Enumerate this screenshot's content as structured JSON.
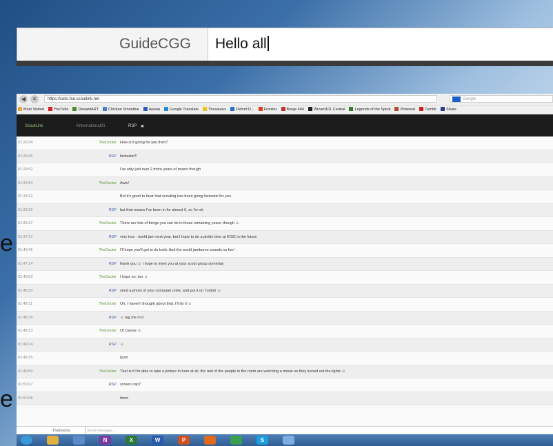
{
  "slide_fragments": {
    "upper_letter": "e",
    "lower_letter": "e"
  },
  "zoom_input": {
    "nick": "GuideCGG",
    "value": "Hello all"
  },
  "browser": {
    "url": "https://cells.hut.scoutlink.net",
    "search_placeholder": "Google",
    "bookmarks": [
      "Most Visited",
      "YouTube",
      "DeviantART",
      "Chicken Smoothie",
      "Ayuwa",
      "Google Translate",
      "Thesaurus",
      "Oxford D...",
      "Frontier",
      "Borge 494",
      "Wizard101 Central",
      "Legends of the Spiral",
      "Pinterest",
      "Tumblr",
      "Share"
    ],
    "app_tabs": [
      "ScoutLink",
      "#international01",
      "RSP"
    ],
    "compose": {
      "nick": "TheDoctor",
      "placeholder": "Send message..."
    }
  },
  "chat_log": [
    {
      "time": "01:29:34",
      "nick": "TheDoctor",
      "text": "How is it going for you then?"
    },
    {
      "time": "01:29:46",
      "nick": "RSP",
      "text": "fantastic!!!"
    },
    {
      "time": "01:29:52",
      "nick": "",
      "text": "I've only just over 2 more years of rovers though"
    },
    {
      "time": "01:32:54",
      "nick": "TheDoctor",
      "text": "Aww!"
    },
    {
      "time": "01:33:22",
      "nick": "",
      "text": "But it's good to hear that scouting has been going fantastic for you"
    },
    {
      "time": "01:33:22",
      "nick": "RSP",
      "text": "but that means I've been in for almost 6, so I'm ok"
    },
    {
      "time": "01:36:37",
      "nick": "TheDoctor",
      "text": "There are lots of things you can do in those remaining years, though ☺"
    },
    {
      "time": "01:37:17",
      "nick": "RSP",
      "text": "very true - world jam next year. but I hope to do a pinkie time at KISC in the future"
    },
    {
      "time": "01:40:45",
      "nick": "TheDoctor",
      "text": "I'll hope you'll get to do both. And the world jamboree sounds so fun!"
    },
    {
      "time": "01:47:14",
      "nick": "RSP",
      "text": "thank you ☺ I hope to meet you at your scout group someday"
    },
    {
      "time": "01:48:03",
      "nick": "TheDoctor",
      "text": "I hope so, too ☺"
    },
    {
      "time": "01:48:33",
      "nick": "RSP",
      "text": "send a photo of your computer onlie, and put it on Tumblr ☺"
    },
    {
      "time": "01:48:11",
      "nick": "TheDoctor",
      "text": "Oh, I haven't thought about that. I'll do it ☺"
    },
    {
      "time": "01:48:39",
      "nick": "RSP",
      "text": "☺ tag me in it"
    },
    {
      "time": "01:49:13",
      "nick": "TheDoctor",
      "text": "Of course ☺"
    },
    {
      "time": "01:49:24",
      "nick": "RSP",
      "text": "☺"
    },
    {
      "time": "01:49:25",
      "nick": "",
      "text": "tyvm"
    },
    {
      "time": "01:49:59",
      "nick": "TheDoctor",
      "text": "That is if I'm able to take a picture in here at all, the rest of the people in the room are watching a movie so they turned out the lights ☺"
    },
    {
      "time": "01:50:07",
      "nick": "RSP",
      "text": "screen cap?"
    },
    {
      "time": "01:50:08",
      "nick": "",
      "text": "hmm"
    }
  ],
  "taskbar_icons": [
    "start-orb",
    "explorer",
    "window",
    "onenote",
    "excel",
    "word",
    "powerpoint",
    "firefox",
    "chrome",
    "skype",
    "paint"
  ],
  "colors": {
    "thedoctor_nick": "#5b9a3a",
    "rsp_nick": "#3d5fa8",
    "app_header": "#1b1b1b"
  }
}
